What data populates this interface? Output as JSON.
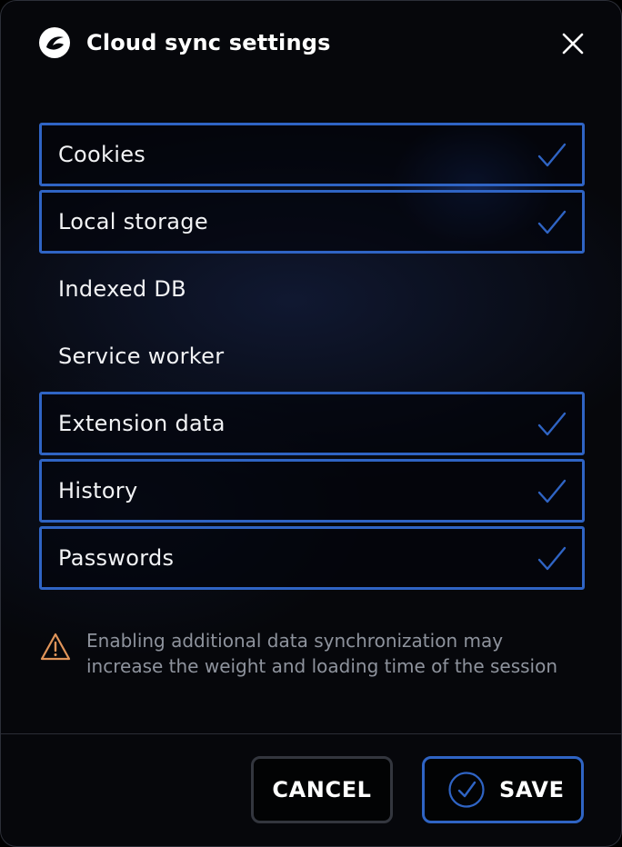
{
  "dialog": {
    "title": "Cloud sync settings",
    "app_icon": "app-logo-icon",
    "close_icon": "close-icon",
    "accent_color": "#2f64c4",
    "warning_color": "#e1955a"
  },
  "options": [
    {
      "label": "Cookies",
      "checked": true
    },
    {
      "label": "Local storage",
      "checked": true
    },
    {
      "label": "Indexed DB",
      "checked": false
    },
    {
      "label": "Service worker",
      "checked": false
    },
    {
      "label": "Extension data",
      "checked": true
    },
    {
      "label": "History",
      "checked": true
    },
    {
      "label": "Passwords",
      "checked": true
    }
  ],
  "warning": {
    "icon": "warning-triangle-icon",
    "text": "Enabling additional data synchronization may increase the weight and loading time of the session"
  },
  "buttons": {
    "cancel_label": "CANCEL",
    "save_label": "SAVE",
    "save_icon": "check-circle-icon"
  }
}
